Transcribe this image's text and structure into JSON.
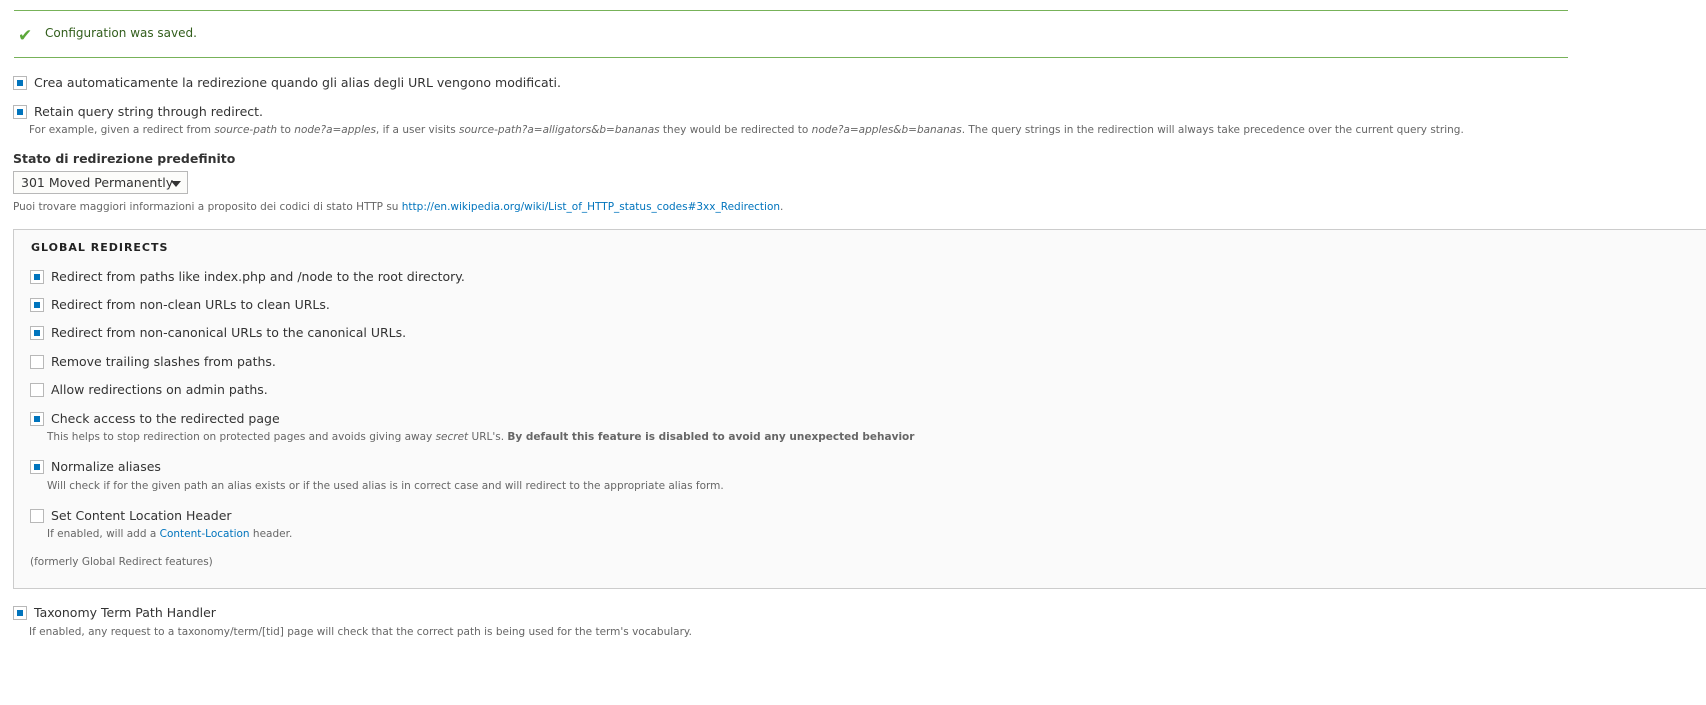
{
  "message": {
    "text": "Configuration was saved.",
    "icon": "checkmark-icon",
    "color": "#77b259"
  },
  "options": [
    {
      "label": "Crea automaticamente la redirezione quando gli alias degli URL vengono modificati.",
      "checked": true
    },
    {
      "label": "Retain query string through redirect.",
      "checked": true,
      "desc": {
        "p1": "For example, given a redirect from ",
        "s1": "source-path",
        "p2": " to ",
        "s2": "node?a=apples",
        "p3": ", if a user visits ",
        "s3": "source-path?a=alligators&b=bananas",
        "p4": " they would be redirected to ",
        "s4": "node?a=apples&b=bananas",
        "p5": ". The query strings in the redirection will always take precedence over the current query string."
      }
    }
  ],
  "status": {
    "label": "Stato di redirezione predefinito",
    "selected": "301 Moved Permanently",
    "help": "Puoi trovare maggiori informazioni a proposito dei codici di stato HTTP su ",
    "link": "http://en.wikipedia.org/wiki/List_of_HTTP_status_codes#3xx_Redirection",
    "help_end": "."
  },
  "global": {
    "legend": "GLOBAL REDIRECTS",
    "items": [
      {
        "label": "Redirect from paths like index.php and /node to the root directory.",
        "checked": true
      },
      {
        "label": "Redirect from non-clean URLs to clean URLs.",
        "checked": true
      },
      {
        "label": "Redirect from non-canonical URLs to the canonical URLs.",
        "checked": true
      },
      {
        "label": "Remove trailing slashes from paths.",
        "checked": false
      },
      {
        "label": "Allow redirections on admin paths.",
        "checked": false
      },
      {
        "label": "Check access to the redirected page",
        "checked": true,
        "desc_a": "This helps to stop redirection on protected pages and avoids giving away ",
        "desc_em": "secret",
        "desc_b": " URL's. ",
        "desc_strong": "By default this feature is disabled to avoid any unexpected behavior"
      },
      {
        "label": "Normalize aliases",
        "checked": true,
        "desc": "Will check if for the given path an alias exists or if the used alias is in correct case and will redirect to the appropriate alias form."
      },
      {
        "label": "Set Content Location Header",
        "checked": false,
        "desc_a": "If enabled, will add a ",
        "desc_link": "Content-Location",
        "desc_b": " header."
      }
    ],
    "note": "(formerly Global Redirect features)"
  },
  "taxonomy": {
    "label": "Taxonomy Term Path Handler",
    "checked": true,
    "desc": "If enabled, any request to a taxonomy/term/[tid] page will check that the correct path is being used for the term's vocabulary."
  }
}
